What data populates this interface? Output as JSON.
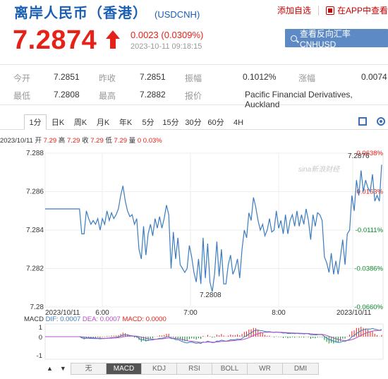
{
  "header": {
    "name": "离岸人民币（香港）",
    "code": "(USDCNH)",
    "add_watchlist": "添加自选",
    "app_view": "在APP中查看"
  },
  "quote": {
    "price": "7.2874",
    "change": "0.0023 (0.0309%)",
    "time": "2023-10-11 09:18:15",
    "cta_label": "查看反向汇率 CNHUSD",
    "trend": "up",
    "up_color": "#e62117"
  },
  "stats": {
    "open_label": "今开",
    "open": "7.2851",
    "prev_label": "昨收",
    "prev": "7.2851",
    "amp_label": "振幅",
    "amp": "0.1012%",
    "chg_label": "涨幅",
    "chg": "0.0074",
    "low_label": "最低",
    "low": "7.2808",
    "high_label": "最高",
    "high": "7.2882",
    "quote_label": "报价",
    "quote": "Pacific Financial Derivatives, Auckland"
  },
  "tabs": [
    "1分",
    "日K",
    "周K",
    "月K",
    "年K",
    "5分",
    "15分",
    "30分",
    "60分",
    "4H"
  ],
  "active_tab": 0,
  "infobar": {
    "date": "2023/10/11",
    "open_l": "开",
    "open": "7.29",
    "high_l": "高",
    "high": "7.29",
    "close_l": "收",
    "close": "7.29",
    "low_l": "低",
    "low": "7.29",
    "vol_l": "量",
    "vol": "0",
    "pct": "0.03%"
  },
  "bottom_tabs": [
    "无",
    "MACD",
    "KDJ",
    "RSI",
    "BOLL",
    "WR",
    "DMI"
  ],
  "bottom_active": 1,
  "bottom_arrows": [
    "▲",
    "▼"
  ],
  "chart_data": {
    "type": "line",
    "title": "",
    "y_ticks": [
      "7.288",
      "7.286",
      "7.284",
      "7.282",
      "7.28"
    ],
    "ylim": [
      7.28,
      7.288
    ],
    "pct_ticks": [
      "0.0638%",
      "0.0163%",
      "-0.0111%",
      "-0.0386%",
      "-0.0660%"
    ],
    "x_ticks": [
      "2023/10/11",
      "6:00",
      "7:00",
      "8:00",
      "2023/10/11"
    ],
    "max_label": "7.2876",
    "min_label": "7.2808",
    "watermark": "sina新浪财经",
    "series": [
      {
        "color": "#3a7cbf",
        "values": [
          7.2851,
          7.2851,
          7.2851,
          7.2851,
          7.2851,
          7.2851,
          7.2851,
          7.2851,
          7.2851,
          7.2851,
          7.2851,
          7.2851,
          7.2851,
          7.2851,
          7.2851,
          7.2851,
          7.2838,
          7.2838,
          7.285,
          7.2846,
          7.2843,
          7.2845,
          7.2843,
          7.2846,
          7.284,
          7.2846,
          7.2843,
          7.285,
          7.2845,
          7.2849,
          7.2846,
          7.2848,
          7.2851,
          7.2858,
          7.2863,
          7.2855,
          7.285,
          7.2847,
          7.2848,
          7.2843,
          7.2846,
          7.283,
          7.2825,
          7.2842,
          7.2827,
          7.2838,
          7.2843,
          7.2837,
          7.2846,
          7.2841,
          7.2847,
          7.2841,
          7.2846,
          7.2853,
          7.2848,
          7.282,
          7.2839,
          7.2825,
          7.2836,
          7.2822,
          7.282,
          7.2818,
          7.282,
          7.2832,
          7.2826,
          7.2818,
          7.2813,
          7.2825,
          7.2812,
          7.2836,
          7.2815,
          7.2833,
          7.2813,
          7.2808,
          7.2817,
          7.2834,
          7.2816,
          7.283,
          7.2812,
          7.2812,
          7.2822,
          7.2827,
          7.2817,
          7.282,
          7.2825,
          7.2815,
          7.283,
          7.284,
          7.2836,
          7.2849,
          7.2845,
          7.2857,
          7.2852,
          7.2845,
          7.284,
          7.2843,
          7.2837,
          7.284,
          7.2846,
          7.2839,
          7.284,
          7.285,
          7.2841,
          7.2845,
          7.2838,
          7.2848,
          7.2838,
          7.2845,
          7.2848,
          7.2842,
          7.285,
          7.2842,
          7.2848,
          7.2843,
          7.2851,
          7.2845,
          7.2835,
          7.2848,
          7.2842,
          7.2849,
          7.2848,
          7.2845,
          7.2826,
          7.2823,
          7.2818,
          7.2828,
          7.2817,
          7.2824,
          7.2817,
          7.2826,
          7.2835,
          7.2822,
          7.2838,
          7.284,
          7.2858,
          7.285,
          7.2866,
          7.2858,
          7.2871,
          7.286,
          7.2866,
          7.2862,
          7.286,
          7.2869,
          7.2855,
          7.2858,
          7.2855,
          7.2874
        ]
      }
    ],
    "macd": {
      "label": "MACD",
      "dif_l": "DIF",
      "dif": "0.0007",
      "dea_l": "DEA",
      "dea": "0.0007",
      "macd_l": "MACD",
      "macd": "0.0000",
      "ticks": [
        "1",
        "0",
        "-1"
      ]
    }
  }
}
